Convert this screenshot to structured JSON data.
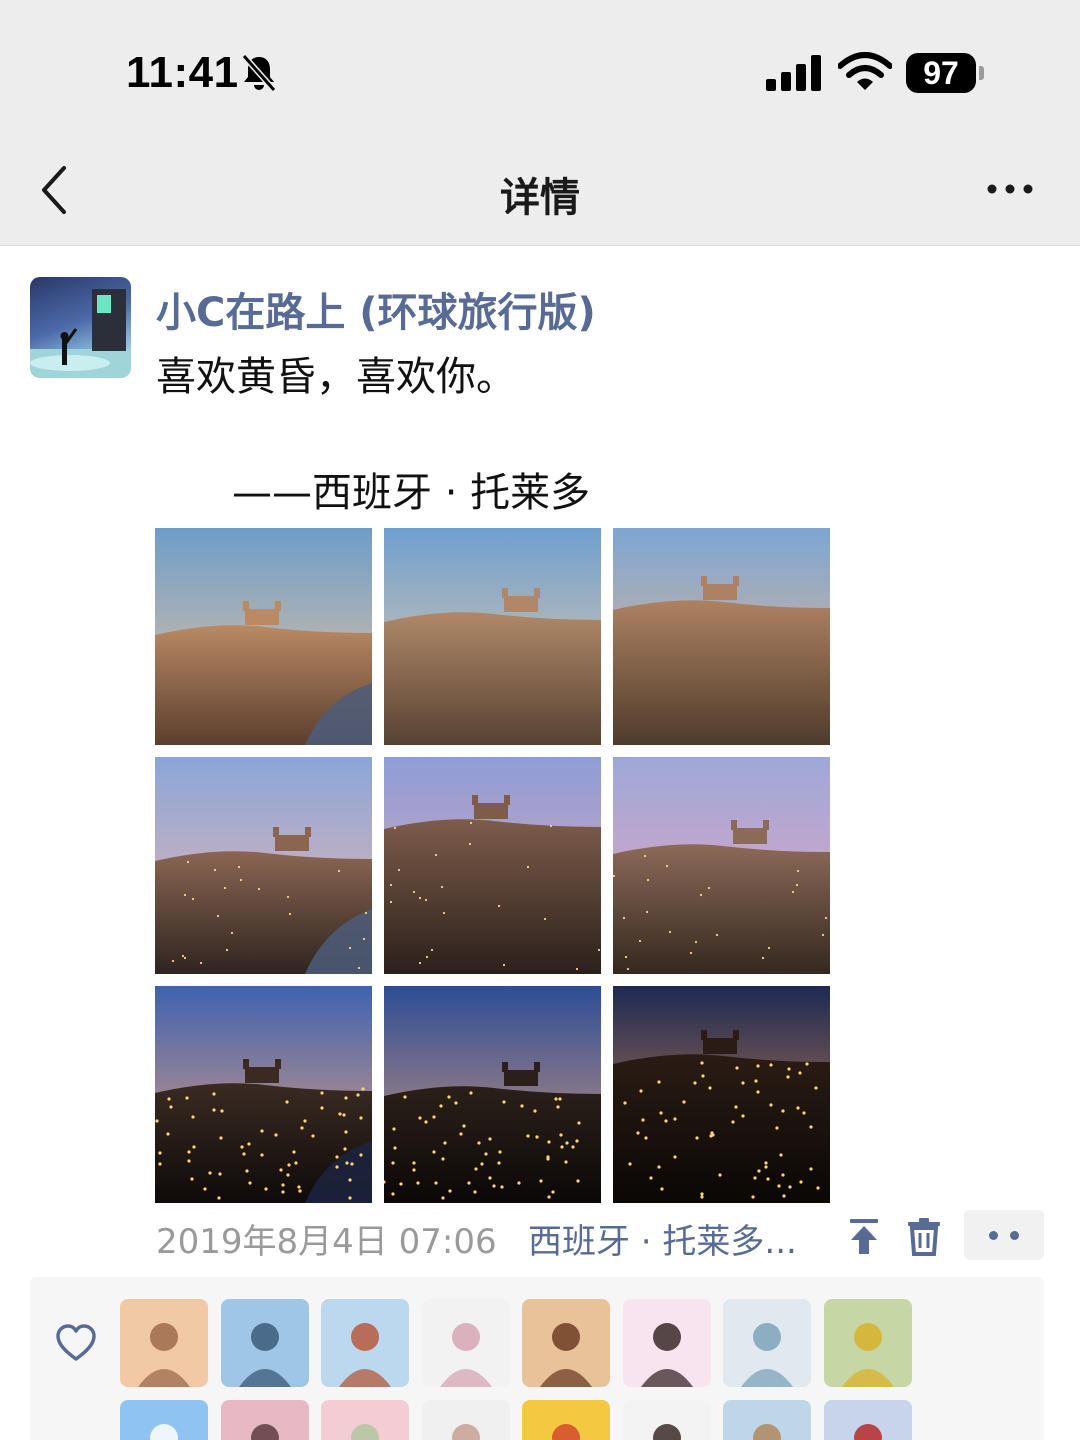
{
  "status_bar": {
    "time": "11:41",
    "battery": "97",
    "icons": [
      "bell-slash-icon",
      "signal-icon",
      "wifi-icon",
      "battery-icon"
    ]
  },
  "nav": {
    "title": "详情",
    "back_icon": "chevron-left-icon",
    "more_icon": "more-dots-icon"
  },
  "post": {
    "nickname": "小C在路上 (环球旅行版)",
    "text_line1": "喜欢黄昏，喜欢你。",
    "text_line2": "——西班牙 · 托莱多",
    "photos": [
      {
        "scene": "sunset-castle"
      },
      {
        "scene": "sunset-cathedral"
      },
      {
        "scene": "sunset-alcazar-close"
      },
      {
        "scene": "dusk-river"
      },
      {
        "scene": "dusk-hill"
      },
      {
        "scene": "dusk-alcazar"
      },
      {
        "scene": "night-river"
      },
      {
        "scene": "night-lights"
      },
      {
        "scene": "night-cathedral"
      }
    ],
    "timestamp": "2019年8月4日 07:06",
    "location": "西班牙 · 托莱多...",
    "actions": [
      "pin-top-icon",
      "trash-icon",
      "more-dots-icon"
    ]
  },
  "likes": {
    "icon": "heart-outline-icon",
    "avatars": [
      {
        "colors": [
          "#f1c9a4",
          "#9c6b4c"
        ]
      },
      {
        "colors": [
          "#9fc6e6",
          "#3c5a7a"
        ]
      },
      {
        "colors": [
          "#bcd8ee",
          "#b65a3c"
        ]
      },
      {
        "colors": [
          "#f2f2f2",
          "#d6a6b4"
        ]
      },
      {
        "colors": [
          "#e8c39a",
          "#6f3d25"
        ]
      },
      {
        "colors": [
          "#f7e4ef",
          "#3a2a2a"
        ]
      },
      {
        "colors": [
          "#dfe9ef",
          "#7ea3b8"
        ]
      },
      {
        "colors": [
          "#c6d6a4",
          "#d8b22c"
        ]
      },
      {
        "colors": [
          "#8fc3f2",
          "#ffffff"
        ]
      },
      {
        "colors": [
          "#e6b9c4",
          "#5e3c40"
        ]
      },
      {
        "colors": [
          "#f3ccd4",
          "#b1c6a0"
        ]
      },
      {
        "colors": [
          "#f0f0f0",
          "#c8a090"
        ]
      },
      {
        "colors": [
          "#f5c842",
          "#d44a2a"
        ]
      },
      {
        "colors": [
          "#f3f3f3",
          "#3b2a25"
        ]
      },
      {
        "colors": [
          "#bdd6e8",
          "#b08a5a"
        ]
      },
      {
        "colors": [
          "#c8d4ec",
          "#b52a2a"
        ]
      }
    ]
  }
}
